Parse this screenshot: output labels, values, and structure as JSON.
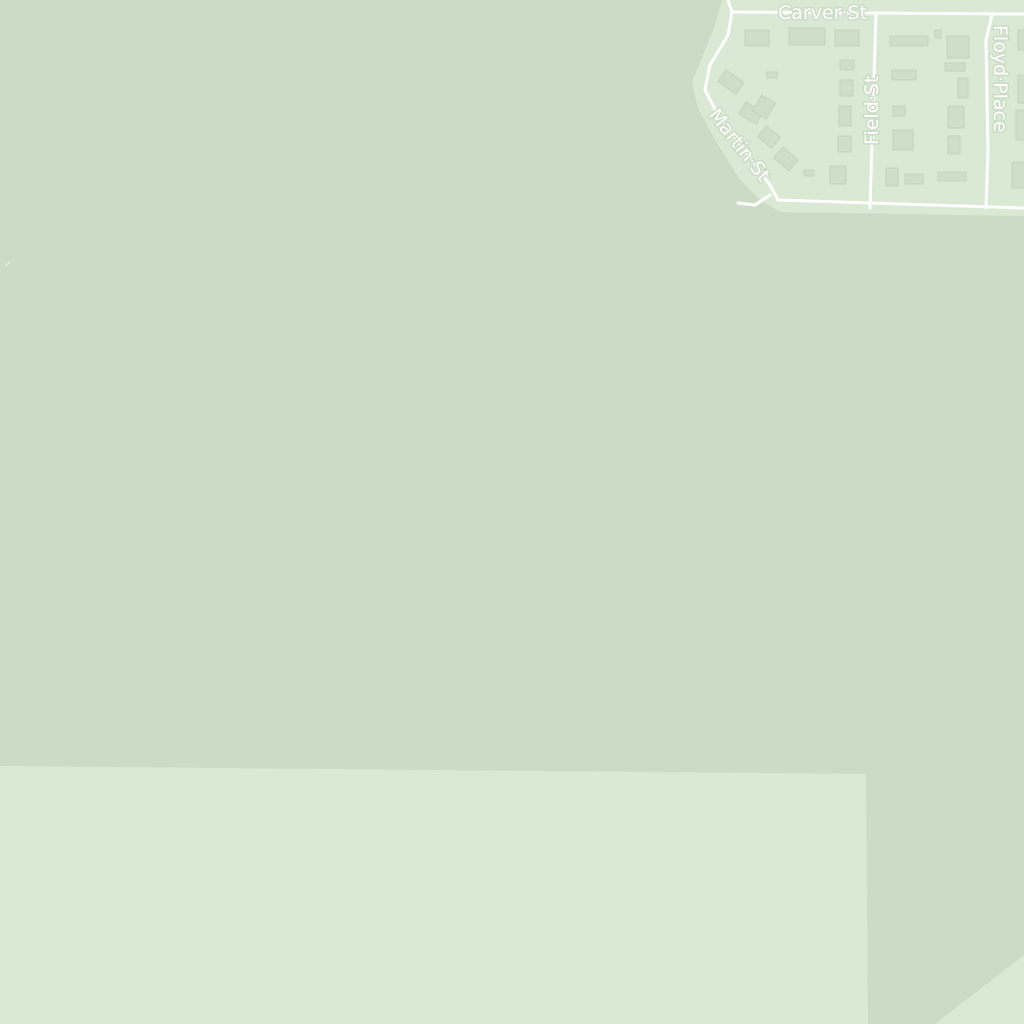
{
  "map": {
    "colors": {
      "park_area": "#ccdbc6",
      "residential_area": "#d9e9d4",
      "building": "#cfdec9",
      "road": "#ffffff"
    },
    "streets": [
      {
        "id": "carver",
        "label": "Carver·St"
      },
      {
        "id": "martin",
        "label": "Martin·St"
      },
      {
        "id": "field",
        "label": "Field·St"
      },
      {
        "id": "floyd",
        "label": "Floyd·Place"
      }
    ]
  }
}
